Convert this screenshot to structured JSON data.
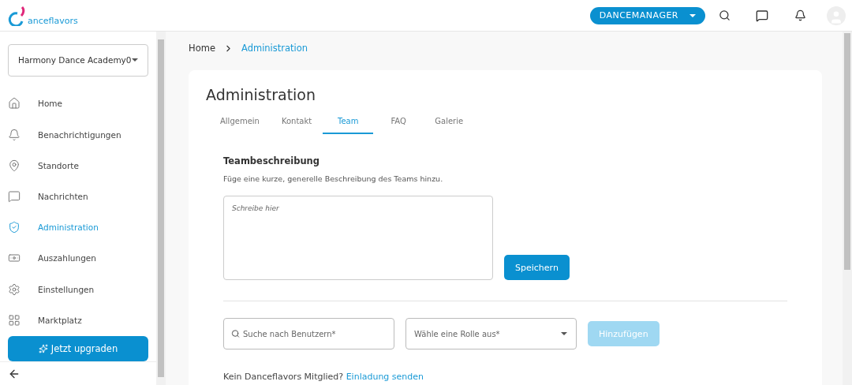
{
  "header": {
    "logo_text": "anceflavors",
    "role_button": "DANCEMANAGER"
  },
  "sidebar": {
    "school": "Harmony Dance Academy0",
    "items": [
      {
        "kind": "home",
        "label": "Home",
        "selected": false
      },
      {
        "kind": "bell",
        "label": "Benachrichtigungen",
        "selected": false
      },
      {
        "kind": "pin",
        "label": "Standorte",
        "selected": false
      },
      {
        "kind": "chat",
        "label": "Nachrichten",
        "selected": false
      },
      {
        "kind": "admin",
        "label": "Administration",
        "selected": true
      },
      {
        "kind": "payout",
        "label": "Auszahlungen",
        "selected": false
      },
      {
        "kind": "settings",
        "label": "Einstellungen",
        "selected": false
      },
      {
        "kind": "grid",
        "label": "Marktplatz",
        "selected": false
      }
    ],
    "upgrade_button": "Jetzt upgraden"
  },
  "breadcrumb": [
    "Home",
    "Administration"
  ],
  "page_title": "Administration",
  "tabs": [
    {
      "label": "Allgemein",
      "selected": false
    },
    {
      "label": "Kontakt",
      "selected": false
    },
    {
      "label": "Team",
      "selected": true
    },
    {
      "label": "FAQ",
      "selected": false
    },
    {
      "label": "Galerie",
      "selected": false
    }
  ],
  "team_description": {
    "heading": "Teambeschreibung",
    "hint": "Füge eine kurze, generelle Beschreibung des Teams hinzu.",
    "placeholder": "Schreibe hier",
    "save_button": "Speichern"
  },
  "add_member": {
    "search_placeholder": "Suche nach Benutzern*",
    "role_placeholder": "Wähle eine Rolle aus*",
    "add_button": "Hinzufügen",
    "add_disabled": true
  },
  "invite": {
    "text": "Kein Danceflavors Mitglied?",
    "link": "Einladung senden"
  }
}
